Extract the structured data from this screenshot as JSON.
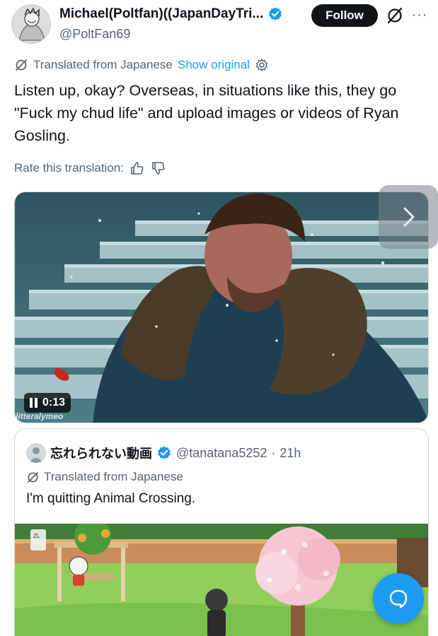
{
  "author": {
    "display_name": "Michael(Poltfan)((JapanDayTri...",
    "handle": "@PoltFan69",
    "follow_label": "Follow"
  },
  "translation": {
    "translated_from": "Translated from Japanese",
    "show_original": "Show original",
    "rate_label": "Rate this translation:"
  },
  "tweet": {
    "text": "Listen up, okay? Overseas, in situations like this, they go \"Fuck my chud life\" and upload images or videos of Ryan Gosling."
  },
  "video": {
    "time": "0:13",
    "watermark": "litteralymeo"
  },
  "quote": {
    "display_name": "忘れられない動画",
    "handle": "@tanatana5252",
    "separator": "·",
    "time": "21h",
    "translated_from": "Translated from Japanese",
    "text": "I'm quitting Animal Crossing.",
    "image_label": "ZL"
  },
  "colors": {
    "accent": "#1d9bf0",
    "text": "#0f1419",
    "secondary": "#536471"
  }
}
